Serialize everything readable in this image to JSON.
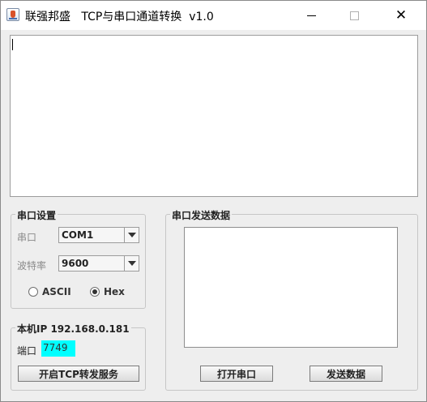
{
  "window": {
    "title": "联强邦盛   TCP与串口通道转换  v1.0",
    "close_glyph": "✕"
  },
  "serial_settings": {
    "group_title": "串口设置",
    "port_label": "串口",
    "port_value": "COM1",
    "baud_label": "波特率",
    "baud_value": "9600",
    "mode_options": [
      {
        "label": "ASCII",
        "selected": false
      },
      {
        "label": "Hex",
        "selected": true
      }
    ]
  },
  "network": {
    "group_title": "本机IP 192.168.0.181",
    "port_label": "端口",
    "port_value": "7749",
    "start_button": "开启TCP转发服务"
  },
  "serial_send": {
    "group_title": "串口发送数据",
    "open_button": "打开串口",
    "send_button": "发送数据"
  },
  "colors": {
    "port_field_bg": "#00ffff",
    "window_bg": "#eeeeee"
  }
}
